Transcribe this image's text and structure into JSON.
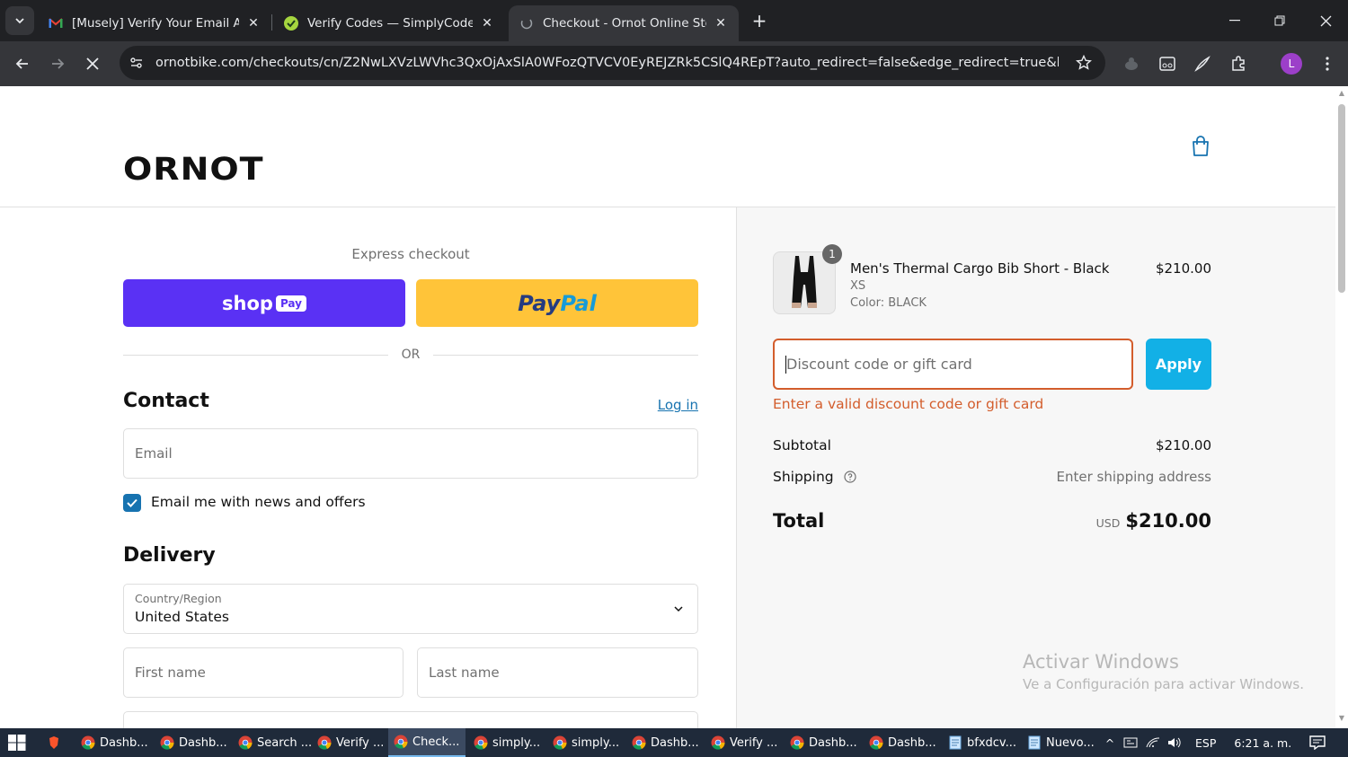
{
  "browser": {
    "tabs": [
      {
        "title": "[Musely] Verify Your Email Addr",
        "icon": "gmail-icon",
        "active": false
      },
      {
        "title": "Verify Codes — SimplyCodes",
        "icon": "simplycodes-icon",
        "active": false
      },
      {
        "title": "Checkout - Ornot Online Store",
        "icon": "loading-icon",
        "active": true
      }
    ],
    "url": "ornotbike.com/checkouts/cn/Z2NwLXVzLWVhc3QxOjAxSlA0WFozQTVCV0EyREJZRk5CSlQ4REpT?auto_redirect=false&edge_redirect=true&locale=...",
    "profile_initial": "L"
  },
  "header": {
    "logo": "ORNOT",
    "cart_icon": "shopping-bag-icon"
  },
  "checkout": {
    "express_label": "Express checkout",
    "shop_pay": {
      "shop": "shop",
      "pay": "Pay"
    },
    "paypal": {
      "pay": "Pay",
      "pal": "Pal"
    },
    "or_text": "OR",
    "contact": {
      "heading": "Contact",
      "login_link": "Log in",
      "email_placeholder": "Email",
      "newsletter_label": "Email me with news and offers",
      "newsletter_checked": true
    },
    "delivery": {
      "heading": "Delivery",
      "country_label": "Country/Region",
      "country_value": "United States",
      "first_name_placeholder": "First name",
      "last_name_placeholder": "Last name"
    }
  },
  "summary": {
    "product": {
      "name": "Men's Thermal Cargo Bib Short - Black",
      "variant": "XS",
      "color": "Color: BLACK",
      "price": "$210.00",
      "quantity": "1"
    },
    "discount": {
      "placeholder": "Discount code or gift card",
      "apply_label": "Apply",
      "error": "Enter a valid discount code or gift card"
    },
    "subtotal_label": "Subtotal",
    "subtotal_value": "$210.00",
    "shipping_label": "Shipping",
    "shipping_value": "Enter shipping address",
    "total_label": "Total",
    "total_currency": "USD",
    "total_value": "$210.00"
  },
  "watermark": {
    "line1": "Activar Windows",
    "line2": "Ve a Configuración para activar Windows."
  },
  "taskbar": {
    "items": [
      {
        "label": "Dashb...",
        "active": false
      },
      {
        "label": "Dashb...",
        "active": false
      },
      {
        "label": "Search ...",
        "active": false
      },
      {
        "label": "Verify ...",
        "active": false
      },
      {
        "label": "Check...",
        "active": true
      },
      {
        "label": "simply...",
        "active": false
      },
      {
        "label": "simply...",
        "active": false
      },
      {
        "label": "Dashb...",
        "active": false
      },
      {
        "label": "Verify ...",
        "active": false
      },
      {
        "label": "Dashb...",
        "active": false
      },
      {
        "label": "Dashb...",
        "active": false
      },
      {
        "label": "bfxdcv...",
        "active": false
      },
      {
        "label": "Nuevo...",
        "active": false
      }
    ],
    "language": "ESP",
    "time": "6:21 a. m."
  }
}
